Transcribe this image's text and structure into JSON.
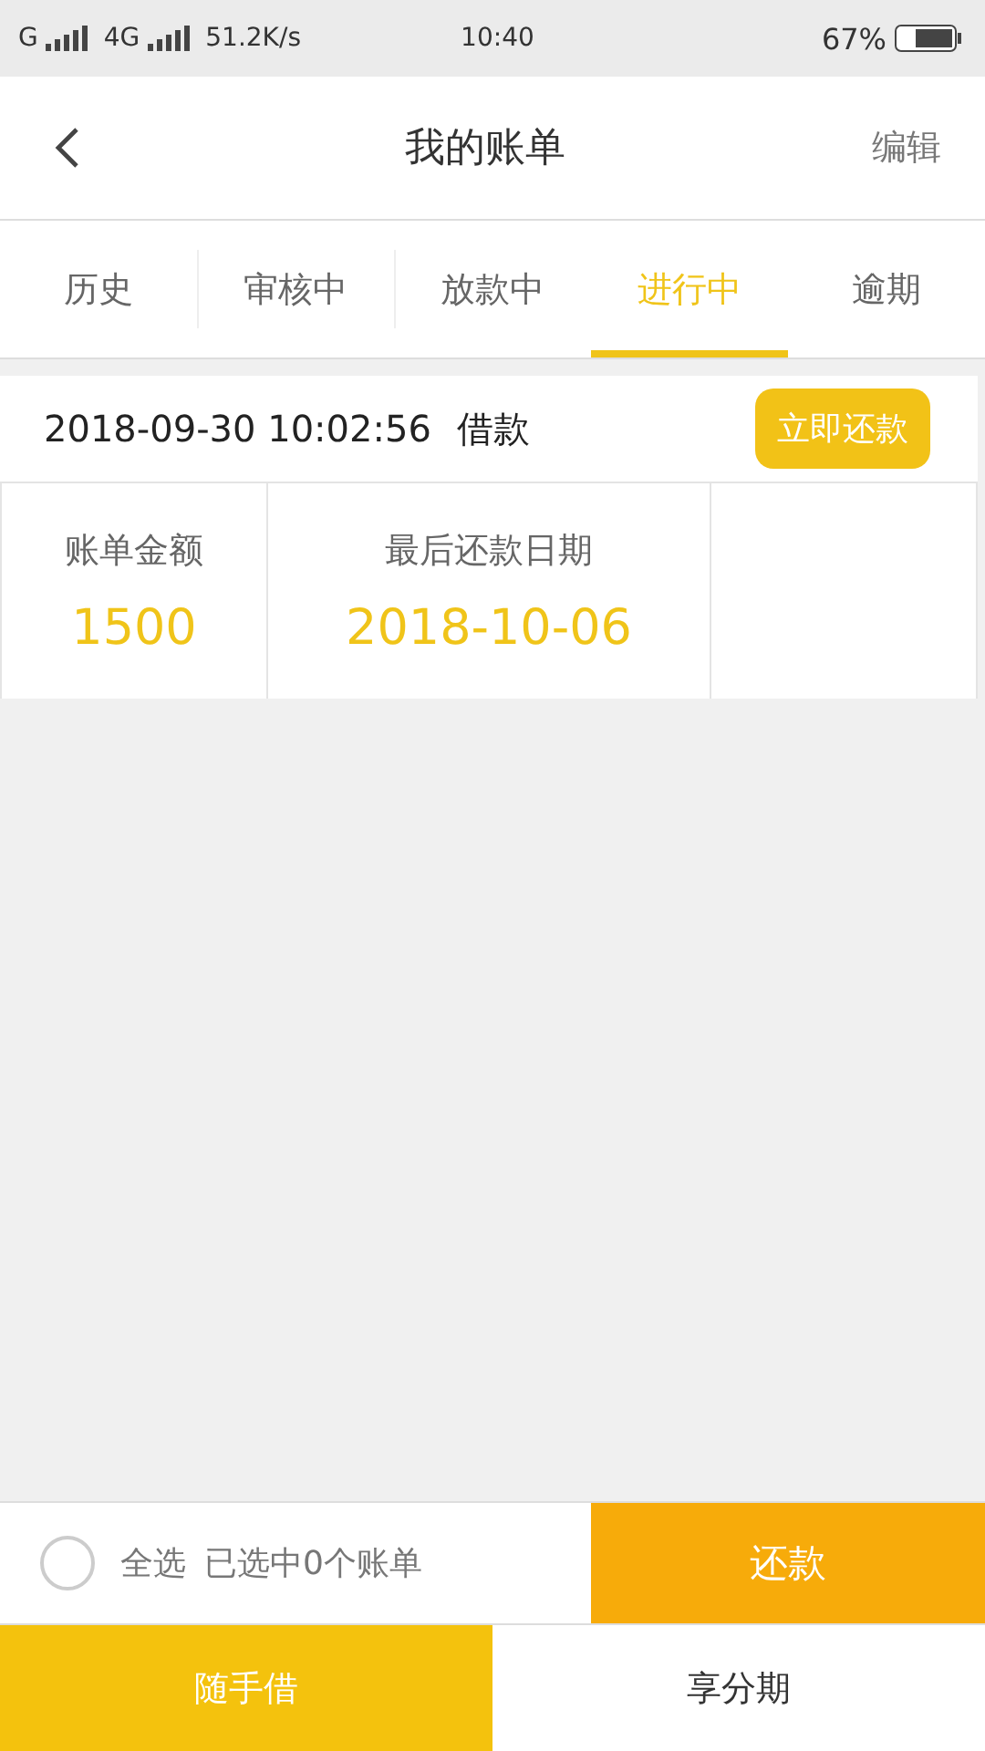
{
  "status_bar": {
    "network_1": "G",
    "network_2": "4G",
    "speed": "51.2K/s",
    "time": "10:40",
    "battery": "67%"
  },
  "header": {
    "title": "我的账单",
    "action": "编辑"
  },
  "tabs": [
    {
      "label": "历史",
      "selected": false
    },
    {
      "label": "审核中",
      "selected": false
    },
    {
      "label": "放款中",
      "selected": false
    },
    {
      "label": "进行中",
      "selected": true
    },
    {
      "label": "逾期",
      "selected": false
    }
  ],
  "bills": [
    {
      "datetime": "2018-09-30 10:02:56",
      "type": "借款",
      "button": "立即还款",
      "fields": [
        {
          "label": "账单金额",
          "value": "1500"
        },
        {
          "label": "最后还款日期",
          "value": "2018-10-06"
        }
      ]
    }
  ],
  "select_bar": {
    "checked": false,
    "select_all": "全选",
    "summary": "已选中0个账单",
    "button": "还款"
  },
  "bottom_nav": [
    {
      "label": "随手借",
      "selected": true
    },
    {
      "label": "享分期",
      "selected": false
    }
  ]
}
